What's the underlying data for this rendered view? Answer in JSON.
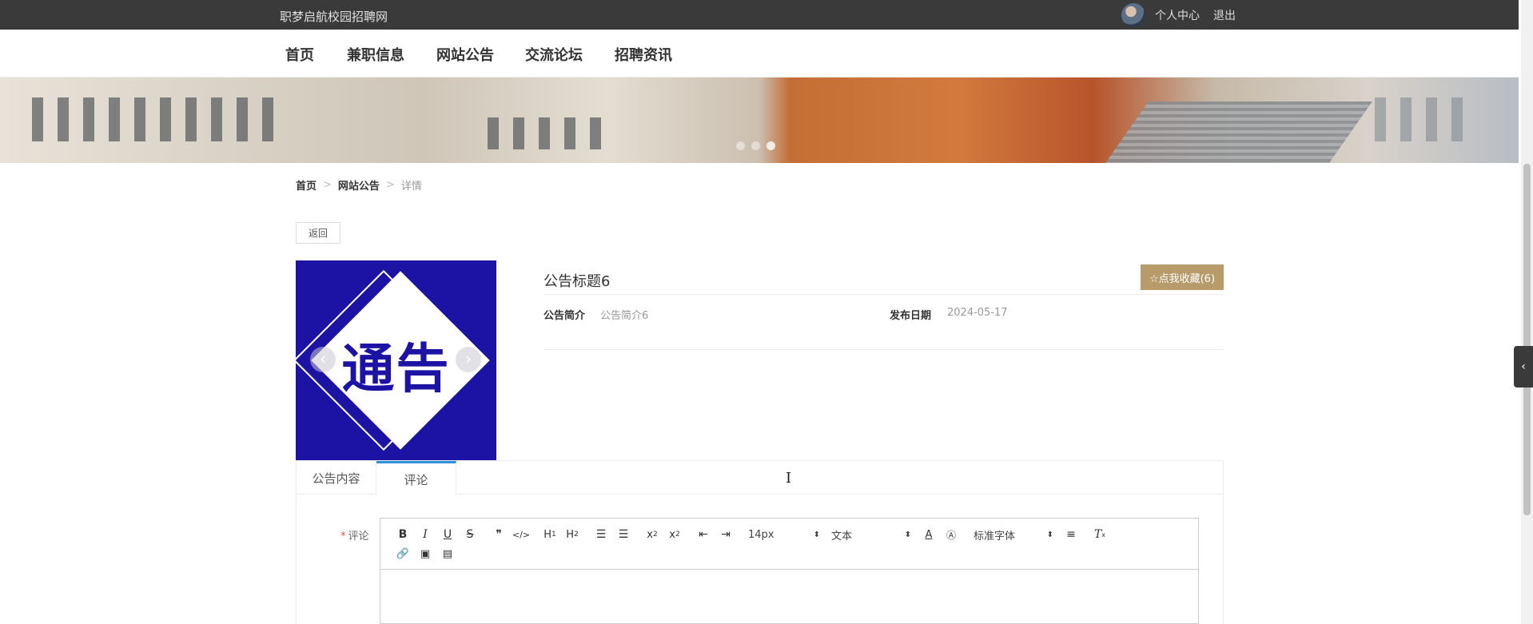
{
  "topbar": {
    "site_name": "职梦启航校园招聘网",
    "user_center": "个人中心",
    "logout": "退出"
  },
  "nav": {
    "items": [
      "首页",
      "兼职信息",
      "网站公告",
      "交流论坛",
      "招聘资讯"
    ]
  },
  "banner": {
    "dots_count": 3,
    "active_dot": 3
  },
  "breadcrumb": {
    "home": "首页",
    "section": "网站公告",
    "separator": ">",
    "current": "详情"
  },
  "actions": {
    "back": "返回",
    "favorite": "☆点我收藏(6)"
  },
  "notice_image": {
    "text": "通告",
    "prev_arrow": "‹",
    "next_arrow": "›"
  },
  "detail": {
    "title": "公告标题6",
    "intro_label": "公告简介",
    "intro_value": "公告简介6",
    "date_label": "发布日期",
    "date_value": "2024-05-17"
  },
  "tabs": {
    "items": [
      "公告内容",
      "评论"
    ],
    "active": 1
  },
  "comment_form": {
    "required_mark": "*",
    "label": "评论"
  },
  "editor": {
    "font_size": "14px",
    "header_type": "文本",
    "font_family": "标准字体"
  },
  "side_toggle": "‹",
  "colors": {
    "topbar": "#3a3a3a",
    "favorite_button": "#b89b6b",
    "notice_blue": "#1c12a4",
    "active_tab": "#2f8fd6"
  }
}
